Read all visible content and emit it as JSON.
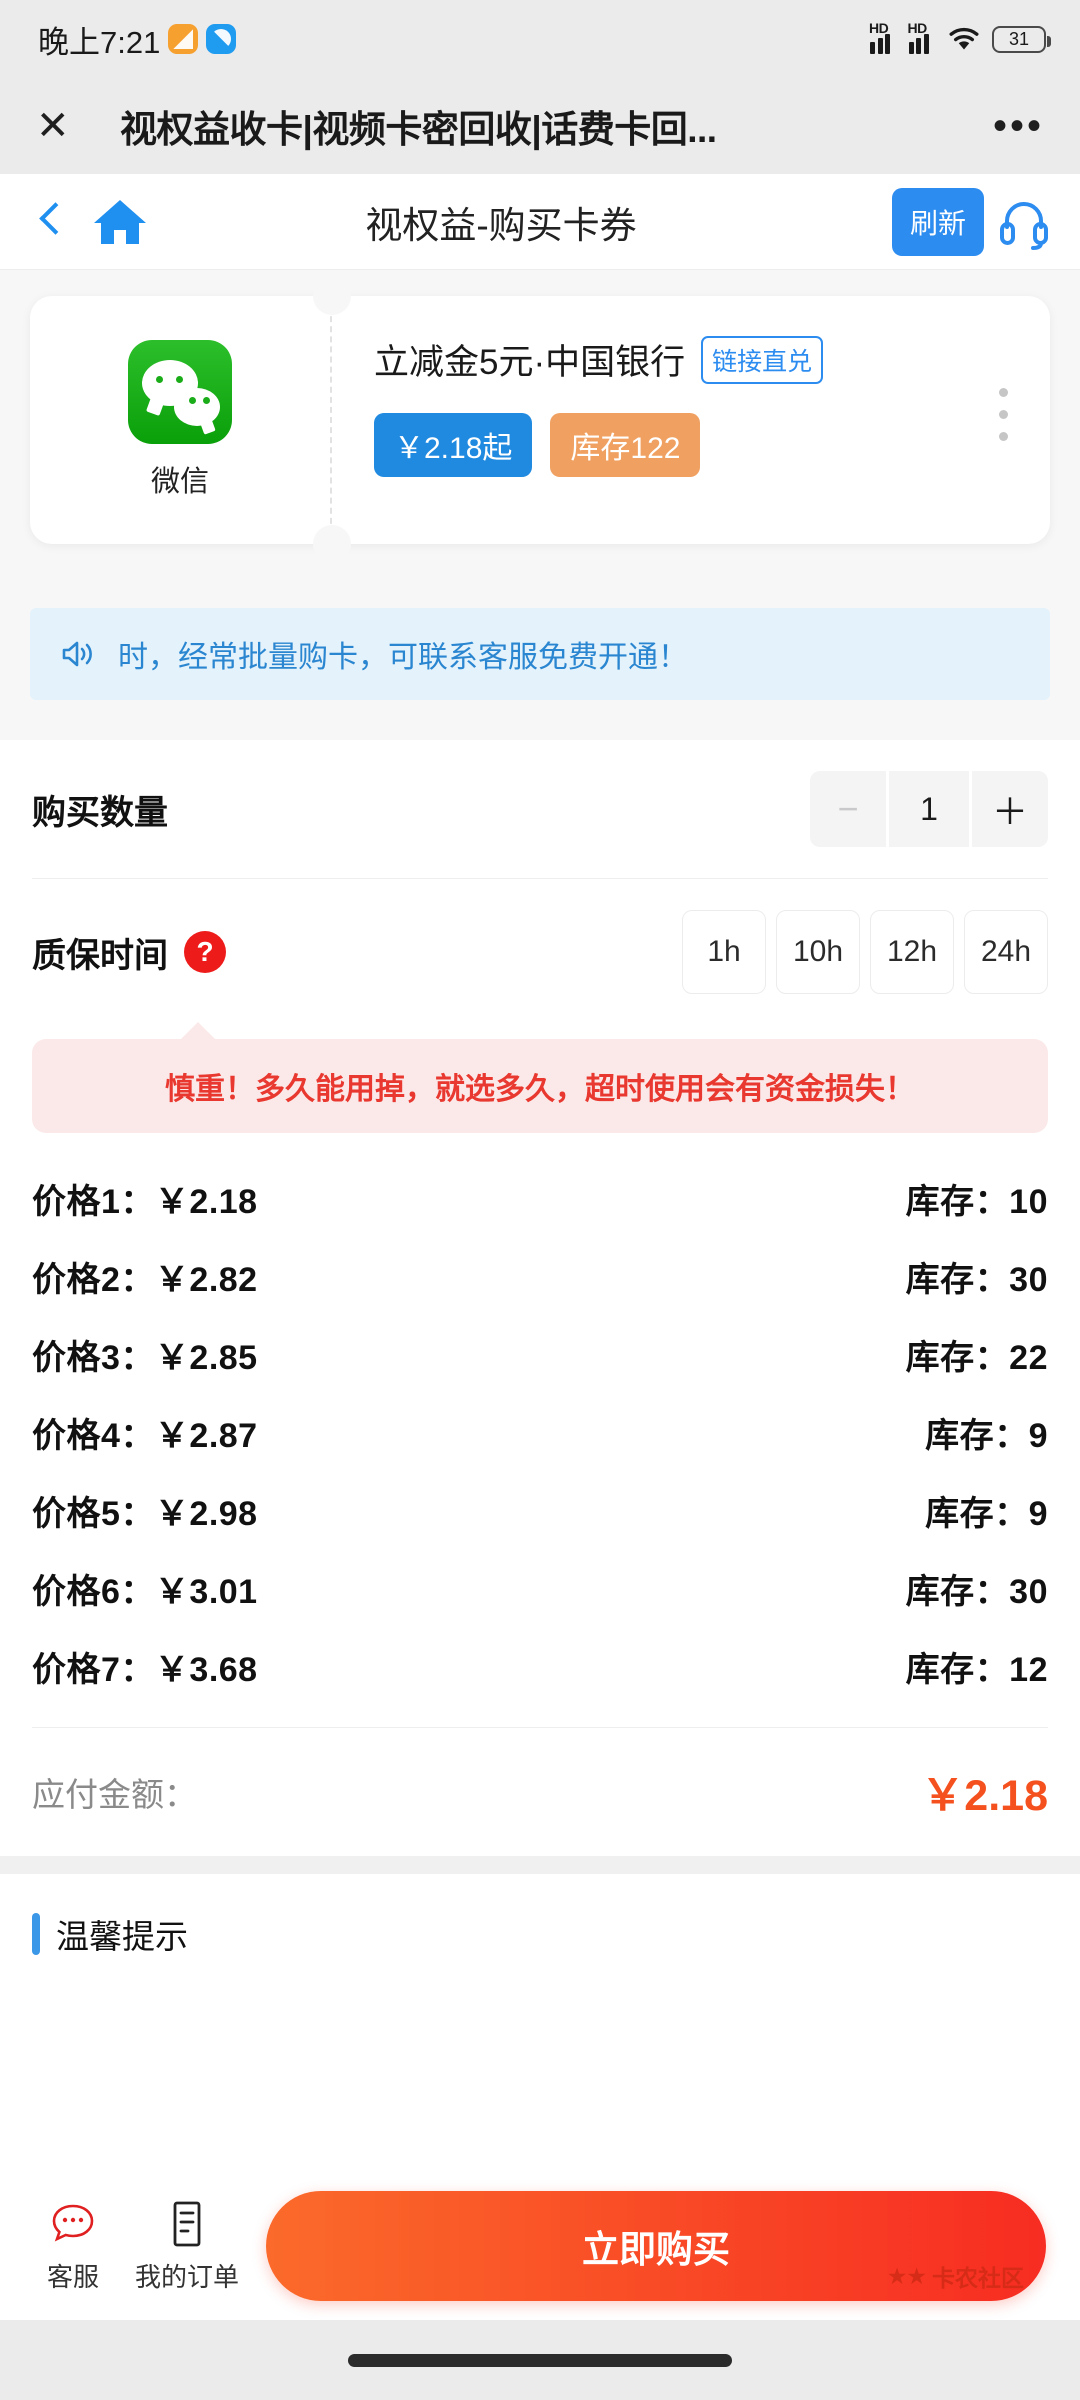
{
  "status_bar": {
    "time": "晚上7:21",
    "hd_label": "HD",
    "battery": "31",
    "icons": [
      "app-orange-icon",
      "app-blue-icon",
      "signal-hd-icon",
      "signal-hd-icon-2",
      "wifi-icon",
      "battery-icon"
    ]
  },
  "title_bar": {
    "close_label": "✕",
    "title": "视权益收卡|视频卡密回收|话费卡回...",
    "more_label": "•••"
  },
  "nav_bar": {
    "back_label": "",
    "home_label": "",
    "title": "视权益-购买卡券",
    "refresh_label": "刷新",
    "service_label": ""
  },
  "product_card": {
    "brand_label": "微信",
    "brand_icon": "wechat-icon",
    "title": "立减金5元·中国银行",
    "tag": "链接直兑",
    "price_pill": "￥2.18起",
    "stock_pill": "库存122",
    "menu_label": "⋮"
  },
  "notice": {
    "icon": "speaker-icon",
    "text": "时，经常批量购卡，可联系客服免费开通！",
    "bg_color": "#e4f2fb",
    "text_color": "#2a86d0"
  },
  "quantity": {
    "label": "购买数量",
    "minus_label": "−",
    "value": "1",
    "plus_label": "＋"
  },
  "guarantee": {
    "label": "质保时间",
    "help_label": "?",
    "options": [
      "1h",
      "10h",
      "12h",
      "24h"
    ],
    "selected": "",
    "warning": "慎重！多久能用掉，就选多久，超时使用会有资金损失！",
    "warning_color": "#e8382f"
  },
  "price_list": {
    "rows": [
      {
        "label": "价格1：￥2.18",
        "stock": "库存：10"
      },
      {
        "label": "价格2：￥2.82",
        "stock": "库存：30"
      },
      {
        "label": "价格3：￥2.85",
        "stock": "库存：22"
      },
      {
        "label": "价格4：￥2.87",
        "stock": "库存：9"
      },
      {
        "label": "价格5：￥2.98",
        "stock": "库存：9"
      },
      {
        "label": "价格6：￥3.01",
        "stock": "库存：30"
      },
      {
        "label": "价格7：￥3.68",
        "stock": "库存：12"
      }
    ]
  },
  "total": {
    "label": "应付金额：",
    "value": "￥2.18",
    "value_color": "#f4511e"
  },
  "tips": {
    "title": "温馨提示"
  },
  "bottom_bar": {
    "service_label": "客服",
    "orders_label": "我的订单",
    "buy_label": "立即购买",
    "watermark": "卡农社区"
  }
}
